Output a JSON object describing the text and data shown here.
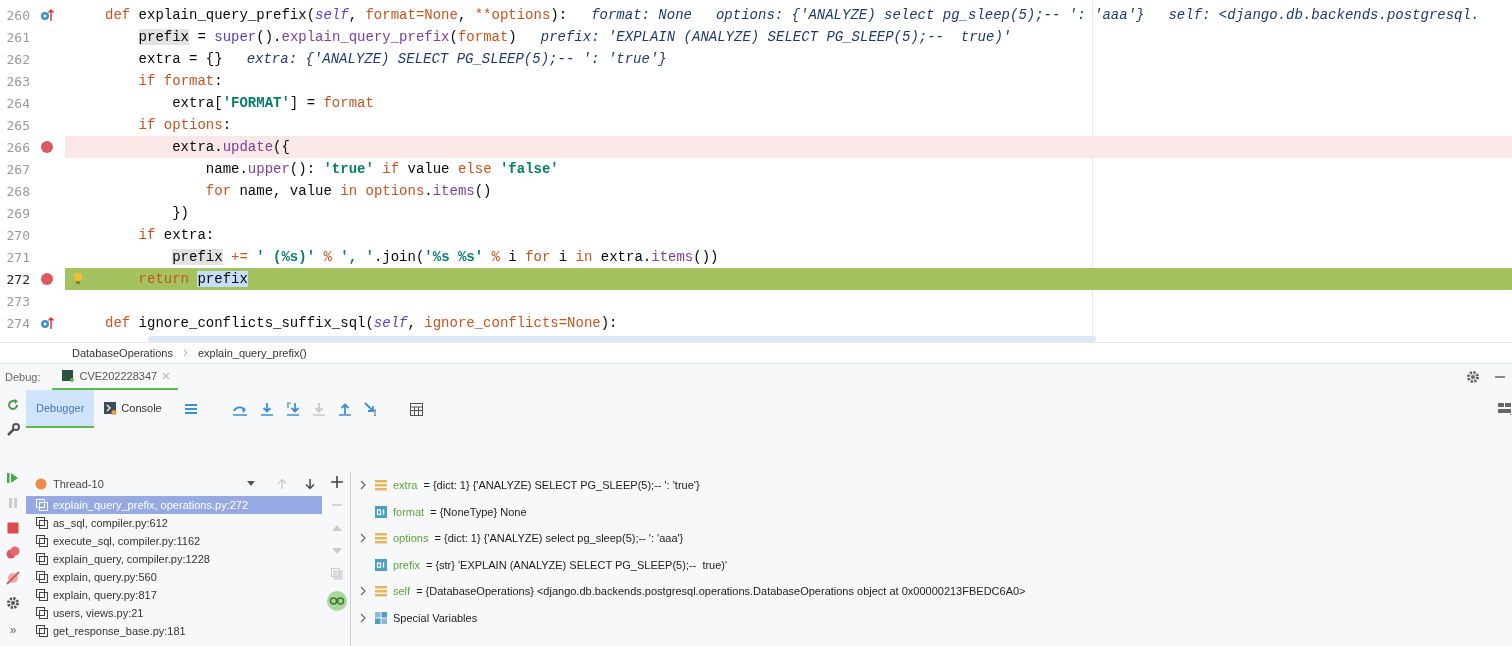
{
  "editor": {
    "lines": [
      {
        "number": "260",
        "overridden": true,
        "breakpoint": false,
        "current": false,
        "intention": false,
        "code": [
          {
            "t": "def ",
            "kind": "keyword"
          },
          {
            "t": "explain_query_prefix(",
            "kind": "plain"
          },
          {
            "t": "self",
            "kind": "self"
          },
          {
            "t": ", ",
            "kind": "plain"
          },
          {
            "t": "format=None",
            "kind": "param"
          },
          {
            "t": ", ",
            "kind": "plain"
          },
          {
            "t": "**options",
            "kind": "param"
          },
          {
            "t": "):",
            "kind": "plain"
          }
        ],
        "hints": [
          "format: None",
          "options: {'ANALYZE) select pg_sleep(5);-- ': 'aaa'}",
          "self: <django.db.backends.postgresql."
        ]
      },
      {
        "number": "261",
        "overridden": false,
        "breakpoint": false,
        "current": false,
        "intention": false,
        "code": [
          {
            "t": "    prefix",
            "kind": "usage"
          },
          {
            "t": " = ",
            "kind": "plain"
          },
          {
            "t": "super",
            "kind": "builtin"
          },
          {
            "t": "().",
            "kind": "plain"
          },
          {
            "t": "explain_query_prefix",
            "kind": "call"
          },
          {
            "t": "(",
            "kind": "plain"
          },
          {
            "t": "format",
            "kind": "param"
          },
          {
            "t": ")",
            "kind": "plain"
          }
        ],
        "hints": [
          "prefix: 'EXPLAIN (ANALYZE) SELECT PG_SLEEP(5);--  true)'"
        ]
      },
      {
        "number": "262",
        "overridden": false,
        "breakpoint": false,
        "current": false,
        "intention": false,
        "code": [
          {
            "t": "    extra = {}",
            "kind": "plain"
          }
        ],
        "hints": [
          "extra: {'ANALYZE) SELECT PG_SLEEP(5);-- ': 'true'}"
        ]
      },
      {
        "number": "263",
        "overridden": false,
        "breakpoint": false,
        "current": false,
        "intention": false,
        "code": [
          {
            "t": "    if ",
            "kind": "keyword"
          },
          {
            "t": "format",
            "kind": "param"
          },
          {
            "t": ":",
            "kind": "plain"
          }
        ]
      },
      {
        "number": "264",
        "overridden": false,
        "breakpoint": false,
        "current": false,
        "intention": false,
        "code": [
          {
            "t": "        extra[",
            "kind": "plain"
          },
          {
            "t": "'FORMAT'",
            "kind": "string"
          },
          {
            "t": "] = ",
            "kind": "plain"
          },
          {
            "t": "format",
            "kind": "param"
          }
        ]
      },
      {
        "number": "265",
        "overridden": false,
        "breakpoint": false,
        "current": false,
        "intention": false,
        "code": [
          {
            "t": "    if ",
            "kind": "keyword"
          },
          {
            "t": "options",
            "kind": "param"
          },
          {
            "t": ":",
            "kind": "plain"
          }
        ]
      },
      {
        "number": "266",
        "overridden": false,
        "breakpoint": true,
        "current": false,
        "intention": false,
        "code": [
          {
            "t": "        extra.",
            "kind": "plain"
          },
          {
            "t": "update",
            "kind": "call"
          },
          {
            "t": "({",
            "kind": "plain"
          }
        ]
      },
      {
        "number": "267",
        "overridden": false,
        "breakpoint": false,
        "current": false,
        "intention": false,
        "code": [
          {
            "t": "            name.",
            "kind": "plain"
          },
          {
            "t": "upper",
            "kind": "call"
          },
          {
            "t": "(): ",
            "kind": "plain"
          },
          {
            "t": "'true'",
            "kind": "string"
          },
          {
            "t": " if ",
            "kind": "keyword"
          },
          {
            "t": "value ",
            "kind": "plain"
          },
          {
            "t": "else ",
            "kind": "keyword"
          },
          {
            "t": "'false'",
            "kind": "string"
          }
        ]
      },
      {
        "number": "268",
        "overridden": false,
        "breakpoint": false,
        "current": false,
        "intention": false,
        "code": [
          {
            "t": "            for ",
            "kind": "keyword"
          },
          {
            "t": "name, value ",
            "kind": "plain"
          },
          {
            "t": "in ",
            "kind": "keyword"
          },
          {
            "t": "options",
            "kind": "param"
          },
          {
            "t": ".",
            "kind": "plain"
          },
          {
            "t": "items",
            "kind": "call"
          },
          {
            "t": "()",
            "kind": "plain"
          }
        ]
      },
      {
        "number": "269",
        "overridden": false,
        "breakpoint": false,
        "current": false,
        "intention": false,
        "code": [
          {
            "t": "        })",
            "kind": "plain"
          }
        ]
      },
      {
        "number": "270",
        "overridden": false,
        "breakpoint": false,
        "current": false,
        "intention": false,
        "code": [
          {
            "t": "    if ",
            "kind": "keyword"
          },
          {
            "t": "extra:",
            "kind": "plain"
          }
        ]
      },
      {
        "number": "271",
        "overridden": false,
        "breakpoint": false,
        "current": false,
        "intention": false,
        "code": [
          {
            "t": "        prefix",
            "kind": "usage"
          },
          {
            "t": " += ",
            "kind": "keyword"
          },
          {
            "t": "' (%s)'",
            "kind": "string"
          },
          {
            "t": " % ",
            "kind": "keyword"
          },
          {
            "t": "', '",
            "kind": "string"
          },
          {
            "t": ".join(",
            "kind": "plain"
          },
          {
            "t": "'%s %s'",
            "kind": "string"
          },
          {
            "t": " % ",
            "kind": "keyword"
          },
          {
            "t": "i ",
            "kind": "plain"
          },
          {
            "t": "for ",
            "kind": "keyword"
          },
          {
            "t": "i ",
            "kind": "plain"
          },
          {
            "t": "in ",
            "kind": "keyword"
          },
          {
            "t": "extra.",
            "kind": "plain"
          },
          {
            "t": "items",
            "kind": "call"
          },
          {
            "t": "())",
            "kind": "plain"
          }
        ]
      },
      {
        "number": "272",
        "overridden": false,
        "breakpoint": true,
        "current": true,
        "intention": true,
        "code": [
          {
            "t": "    return ",
            "kind": "keyword"
          },
          {
            "t": "prefix",
            "kind": "selection"
          }
        ]
      },
      {
        "number": "273",
        "overridden": false,
        "breakpoint": false,
        "current": false,
        "intention": false
      },
      {
        "number": "274",
        "overridden": true,
        "breakpoint": false,
        "current": false,
        "intention": false,
        "code": [
          {
            "t": "def ",
            "kind": "keyword"
          },
          {
            "t": "ignore_conflicts_suffix_sql(",
            "kind": "plain"
          },
          {
            "t": "self",
            "kind": "self"
          },
          {
            "t": ", ",
            "kind": "plain"
          },
          {
            "t": "ignore_conflicts=None",
            "kind": "param"
          },
          {
            "t": "):",
            "kind": "plain"
          }
        ]
      }
    ]
  },
  "breadcrumbs": [
    "DatabaseOperations",
    "explain_query_prefix()"
  ],
  "debug": {
    "label": "Debug:",
    "sessions": [
      {
        "label": "CVE202228347",
        "selected": true
      }
    ],
    "tabs": [
      {
        "label": "Debugger",
        "selected": true
      },
      {
        "label": "Console",
        "selected": false
      }
    ],
    "thread": "Thread-10",
    "frames": [
      {
        "label": "explain_query_prefix, operations.py:272",
        "selected": true
      },
      {
        "label": "as_sql, compiler.py:612",
        "selected": false
      },
      {
        "label": "execute_sql, compiler.py:1162",
        "selected": false
      },
      {
        "label": "explain_query, compiler.py:1228",
        "selected": false
      },
      {
        "label": "explain, query.py:560",
        "selected": false
      },
      {
        "label": "explain, query.py:817",
        "selected": false
      },
      {
        "label": "users, views.py:21",
        "selected": false
      },
      {
        "label": "get_response_base.py:181",
        "selected": false
      }
    ],
    "variables": [
      {
        "kind": "collection",
        "expandable": true,
        "name": "extra",
        "value": "= {dict: 1} {'ANALYZE) SELECT PG_SLEEP(5);-- ': 'true'}"
      },
      {
        "kind": "scalar",
        "expandable": false,
        "name": "format",
        "value": "= {NoneType} None"
      },
      {
        "kind": "collection",
        "expandable": true,
        "name": "options",
        "value": "= {dict: 1} {'ANALYZE) select pg_sleep(5);-- ': 'aaa'}"
      },
      {
        "kind": "scalar",
        "expandable": false,
        "name": "prefix",
        "value": "= {str} 'EXPLAIN (ANALYZE) SELECT PG_SLEEP(5);--  true)'"
      },
      {
        "kind": "collection",
        "expandable": true,
        "name": "self",
        "value": "= {DatabaseOperations} <django.db.backends.postgresql.operations.DatabaseOperations object at 0x00000213FBEDC6A0>"
      },
      {
        "kind": "group",
        "expandable": true,
        "value": "Special Variables"
      }
    ],
    "more_glyph": "»"
  }
}
